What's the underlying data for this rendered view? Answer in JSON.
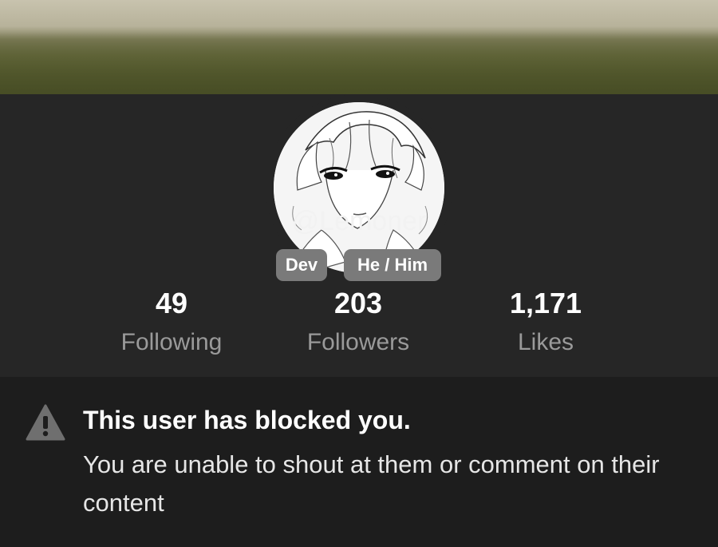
{
  "profile": {
    "badges": {
      "role": "Dev",
      "pronouns": "He / Him"
    },
    "username": "@Lemoner",
    "stats": [
      {
        "value": "49",
        "label": "Following"
      },
      {
        "value": "203",
        "label": "Followers"
      },
      {
        "value": "1,171",
        "label": "Likes"
      }
    ]
  },
  "notice": {
    "icon": "warning-triangle-icon",
    "title": "This user has blocked you.",
    "message": "You are unable to shout at them or comment on their content"
  },
  "colors": {
    "background": "#262626",
    "notice_background": "#1d1d1d",
    "badge": "#7a7a7a",
    "muted_text": "#9a9a9a"
  }
}
